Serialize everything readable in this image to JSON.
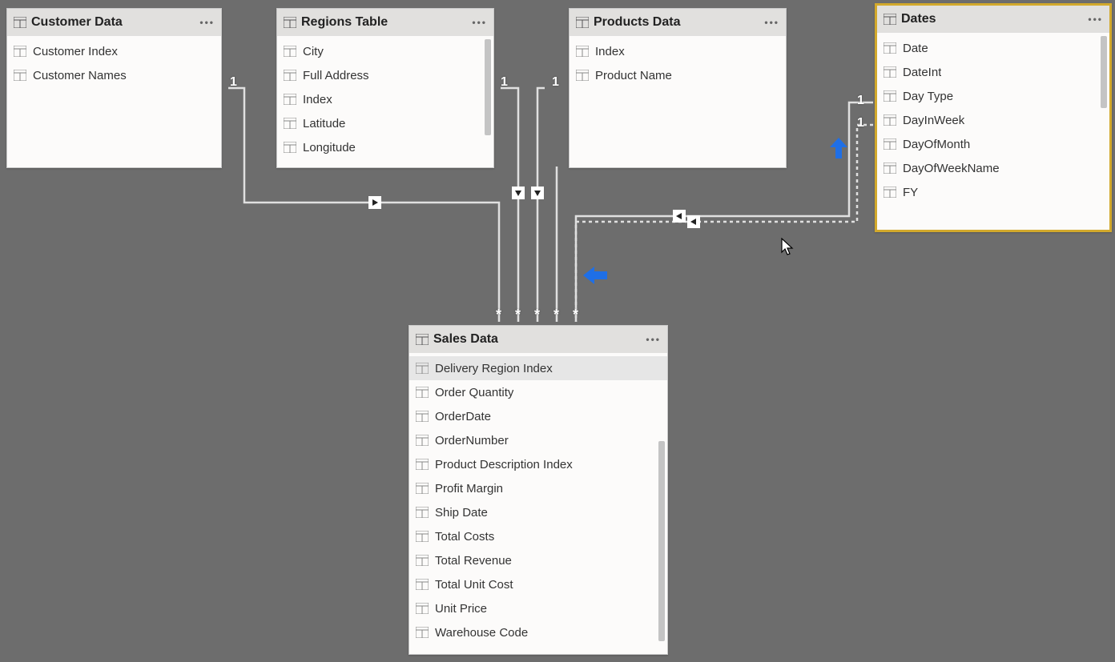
{
  "tables": {
    "customer": {
      "title": "Customer Data",
      "fields": [
        "Customer Index",
        "Customer Names"
      ]
    },
    "regions": {
      "title": "Regions Table",
      "fields": [
        "City",
        "Full Address",
        "Index",
        "Latitude",
        "Longitude"
      ]
    },
    "products": {
      "title": "Products Data",
      "fields": [
        "Index",
        "Product Name"
      ]
    },
    "dates": {
      "title": "Dates",
      "fields": [
        "Date",
        "DateInt",
        "Day Type",
        "DayInWeek",
        "DayOfMonth",
        "DayOfWeekName",
        "FY"
      ]
    },
    "sales": {
      "title": "Sales Data",
      "fields": [
        "Delivery Region Index",
        "Order Quantity",
        "OrderDate",
        "OrderNumber",
        "Product Description Index",
        "Profit Margin",
        "Ship Date",
        "Total Costs",
        "Total Revenue",
        "Total Unit Cost",
        "Unit Price",
        "Warehouse Code"
      ]
    }
  },
  "cardinalities": {
    "c1": "1",
    "c2": "1",
    "c3": "1",
    "c4": "1",
    "c5": "1",
    "s1": "*",
    "s2": "*",
    "s3": "*",
    "s4": "*",
    "s5": "*"
  }
}
